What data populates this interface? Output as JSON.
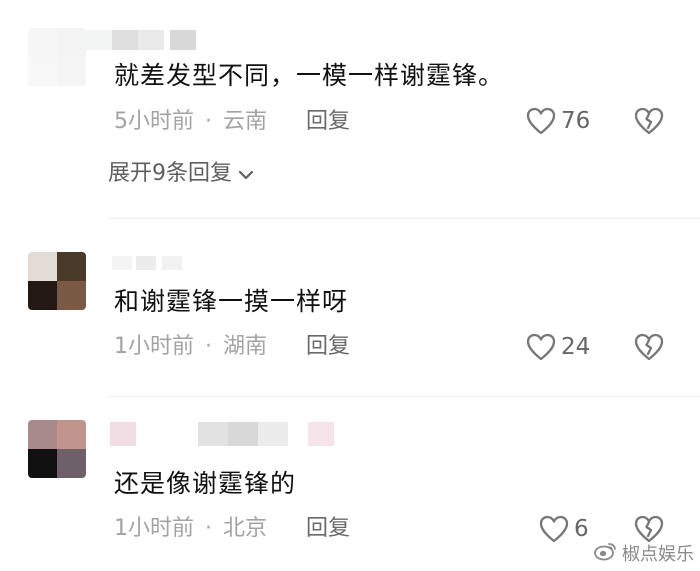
{
  "comments": [
    {
      "text": "就差发型不同，一模一样谢霆锋。",
      "time": "5小时前",
      "separator": "·",
      "location": "云南",
      "reply_label": "回复",
      "likes": "76",
      "expand_label": "展开9条回复",
      "avatar_colors": [
        "#f3f3f3",
        "#efefef",
        "#f6f6f6",
        "#f1f1f1"
      ]
    },
    {
      "text": "和谢霆锋一摸一样呀",
      "time": "1小时前",
      "separator": "·",
      "location": "湖南",
      "reply_label": "回复",
      "likes": "24",
      "avatar_colors": [
        "#e2dbd6",
        "#4a3a2a",
        "#241814",
        "#7a5a44"
      ]
    },
    {
      "text": "还是像谢霆锋的",
      "time": "1小时前",
      "separator": "·",
      "location": "北京",
      "reply_label": "回复",
      "likes": "6",
      "avatar_colors": [
        "#a98a8c",
        "#c2948e",
        "#101010",
        "#6d6068"
      ]
    }
  ],
  "watermark": {
    "icon": "weibo-icon",
    "text": "椒点娱乐"
  },
  "colors": {
    "text": "#111111",
    "meta": "#a3a3a3",
    "reply": "#6a6a6a",
    "icon": "#777777"
  }
}
